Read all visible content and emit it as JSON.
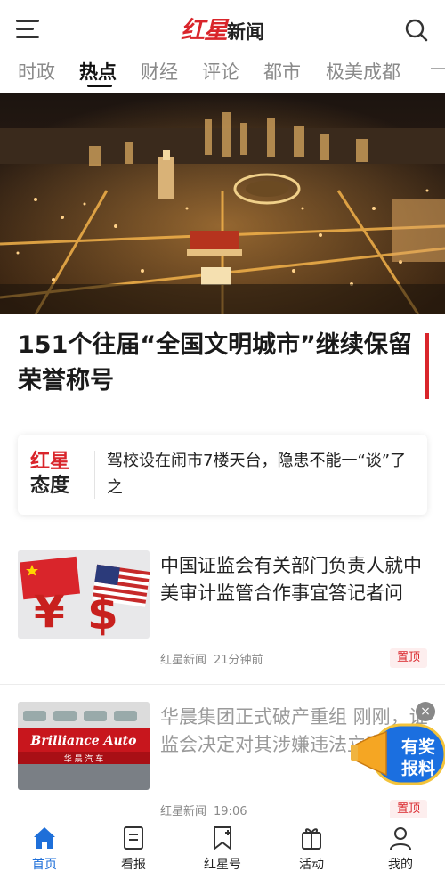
{
  "header": {
    "logo_red": "红星",
    "logo_black": "新闻"
  },
  "tabs": [
    {
      "label": "时政",
      "active": false
    },
    {
      "label": "热点",
      "active": true
    },
    {
      "label": "财经",
      "active": false
    },
    {
      "label": "评论",
      "active": false
    },
    {
      "label": "都市",
      "active": false
    },
    {
      "label": "极美成都",
      "active": false
    }
  ],
  "hero": {
    "headline": "151个往届“全国文明城市”继续保留荣誉称号"
  },
  "attitude": {
    "logo_top": "红星",
    "logo_bottom": "态度",
    "text": "驾校设在闹市7楼天台，隐患不能一“谈”了之"
  },
  "news": [
    {
      "title": "中国证监会有关部门负责人就中美审计监管合作事宜答记者问",
      "source": "红星新闻",
      "time": "21分钟前",
      "badge": "置顶",
      "faded": false
    },
    {
      "title": "华晨集团正式破产重组 刚刚，证监会决定对其涉嫌违法立案调查",
      "source": "红星新闻",
      "time": "19:06",
      "badge": "置顶",
      "faded": true
    }
  ],
  "thumb2_sign": "Brilliance Auto",
  "thumb2_sign_cn": "华 晨 汽 车",
  "float_report": {
    "line1": "有奖",
    "line2": "报料",
    "close": "×"
  },
  "bottom_nav": [
    {
      "label": "首页",
      "icon": "home-icon",
      "active": true
    },
    {
      "label": "看报",
      "icon": "newspaper-icon",
      "active": false
    },
    {
      "label": "红星号",
      "icon": "bookmark-star-icon",
      "active": false
    },
    {
      "label": "活动",
      "icon": "gift-icon",
      "active": false
    },
    {
      "label": "我的",
      "icon": "person-icon",
      "active": false
    }
  ],
  "colors": {
    "brand_red": "#d9252b",
    "nav_active": "#1e6fd9"
  }
}
